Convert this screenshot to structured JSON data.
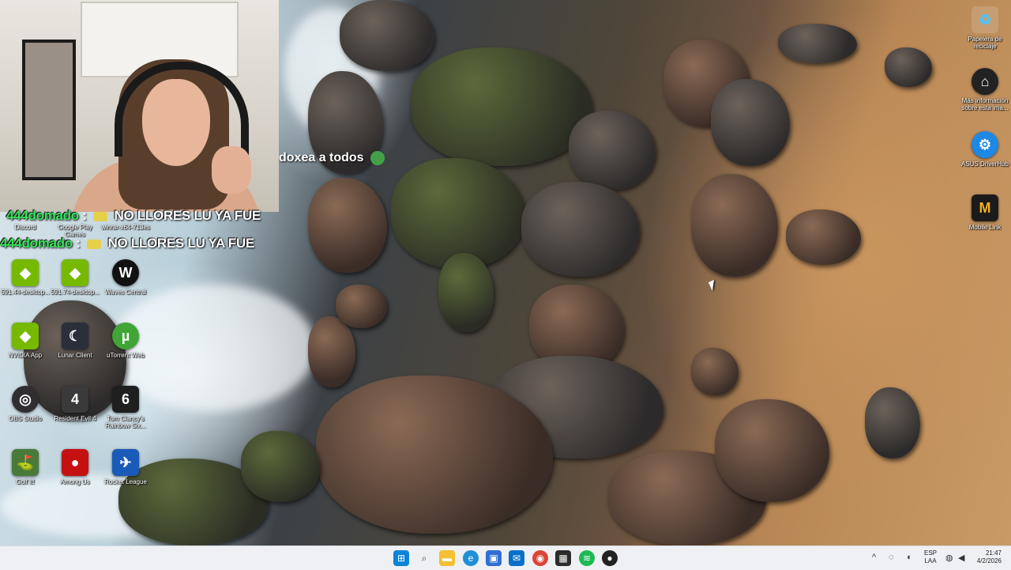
{
  "webcam": {},
  "chat": {
    "small_message": "doxea a todos",
    "lines": [
      {
        "user": "444domado",
        "sep": ":",
        "message": "NO LLORES LU YA FUE"
      },
      {
        "user": "444domado",
        "sep": ":",
        "message": "NO LLORES LU YA FUE"
      }
    ]
  },
  "desktop_left": {
    "icons": [
      {
        "label": "Discord",
        "icon": "discord-icon",
        "color": "#5865f2"
      },
      {
        "label": "Google Play Games",
        "icon": "google-play-games-icon",
        "color": "#2e7d32"
      },
      {
        "label": "winrar-x64-713es",
        "icon": "winrar-icon",
        "color": "#7b3fa0"
      },
      {
        "label": "591.44-desktop...",
        "icon": "nvidia-installer-icon",
        "color": "#76b900"
      },
      {
        "label": "591.74-desktop...",
        "icon": "nvidia-installer-icon",
        "color": "#76b900"
      },
      {
        "label": "Waves Central",
        "icon": "waves-central-icon",
        "color": "#111111"
      },
      {
        "label": "NVIDIA App",
        "icon": "nvidia-app-icon",
        "color": "#76b900"
      },
      {
        "label": "Lunar Client",
        "icon": "lunar-client-icon",
        "color": "#2a2f3a"
      },
      {
        "label": "uTorrent Web",
        "icon": "utorrent-icon",
        "color": "#3fa535"
      },
      {
        "label": "OBS Studio",
        "icon": "obs-studio-icon",
        "color": "#302e31"
      },
      {
        "label": "Resident Evil 4",
        "icon": "resident-evil-4-icon",
        "color": "#3a3a3a"
      },
      {
        "label": "Tom Clancy's Rainbow Six...",
        "icon": "rainbow-six-icon",
        "color": "#1f1f1f"
      },
      {
        "label": "Golf It!",
        "icon": "golf-it-icon",
        "color": "#4a7a3a"
      },
      {
        "label": "Among Us",
        "icon": "among-us-icon",
        "color": "#c51111"
      },
      {
        "label": "Rocket League",
        "icon": "rocket-league-icon",
        "color": "#1a5bb8"
      }
    ]
  },
  "desktop_right": {
    "icons": [
      {
        "label": "Papelera de reciclaje",
        "icon": "recycle-bin-icon",
        "color": "#4fc3f7"
      },
      {
        "label": "Más información sobre esta ima...",
        "icon": "learn-about-picture-icon",
        "color": "#222222"
      },
      {
        "label": "ASUS DriverHub",
        "icon": "asus-driverhub-icon",
        "color": "#1e88e5"
      },
      {
        "label": "Mobile Link",
        "icon": "mobile-link-icon",
        "color": "#1b1b1b"
      }
    ]
  },
  "taskbar": {
    "apps": [
      {
        "name": "start-button",
        "icon": "windows-start-icon",
        "color": "#0a84d8",
        "glyph": "⊞"
      },
      {
        "name": "search-button",
        "icon": "search-icon",
        "color": "#555555",
        "glyph": "⌕"
      },
      {
        "name": "file-explorer-button",
        "icon": "folder-icon",
        "color": "#f3c033",
        "glyph": "▬"
      },
      {
        "name": "edge-button",
        "icon": "edge-icon",
        "color": "#1f8fd6",
        "glyph": "e"
      },
      {
        "name": "store-button",
        "icon": "store-icon",
        "color": "#2f6fd3",
        "glyph": "▣"
      },
      {
        "name": "outlook-button",
        "icon": "mail-icon",
        "color": "#0a6fc9",
        "glyph": "✉"
      },
      {
        "name": "chrome-button",
        "icon": "chrome-icon",
        "color": "#db4437",
        "glyph": "◉"
      },
      {
        "name": "terminal-button",
        "icon": "game-app-icon",
        "color": "#2b2b2b",
        "glyph": "▦"
      },
      {
        "name": "spotify-button",
        "icon": "spotify-icon",
        "color": "#1db954",
        "glyph": "≋"
      },
      {
        "name": "media-app-button",
        "icon": "media-app-icon",
        "color": "#222222",
        "glyph": "●"
      }
    ],
    "tray": {
      "lang_line1": "ESP",
      "lang_line2": "LAA",
      "time": "21:47",
      "date": "4/2/2026"
    }
  }
}
